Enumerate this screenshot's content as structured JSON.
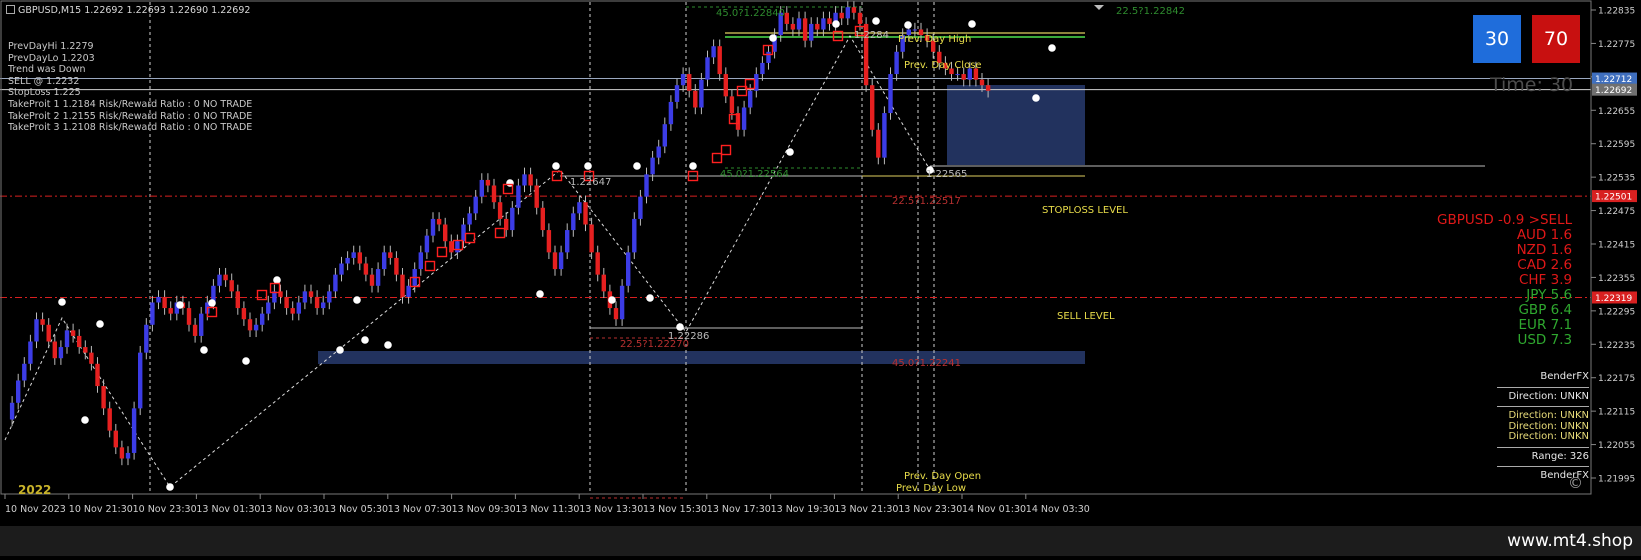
{
  "window": {
    "title": "GBPUSD,M15  1.22692 1.22693 1.22690 1.22692",
    "year_label": "2022"
  },
  "info_panel": [
    "PrevDayHi 1.2279",
    "PrevDayLo 1.2203",
    "Trend was Down",
    "SELL @ 1.2232",
    "StopLoss 1.225",
    "TakeProit 1 1.2184 Risk/Reward Ratio : 0 NO TRADE",
    "TakeProit 2 1.2155 Risk/Reward Ratio : 0 NO TRADE",
    "TakeProit 3 1.2108 Risk/Reward Ratio : 0 NO TRADE"
  ],
  "price_axis": {
    "ticks": [
      "1.22835",
      "1.22775",
      "1.22715",
      "1.22655",
      "1.22595",
      "1.22535",
      "1.22475",
      "1.22415",
      "1.22355",
      "1.22295",
      "1.22235",
      "1.22175",
      "1.22115",
      "1.22055",
      "1.21995"
    ],
    "tags": [
      {
        "label": "1.22712",
        "price": 1.22712,
        "bg": "#3f6fbf"
      },
      {
        "label": "1.22692",
        "price": 1.22692,
        "bg": "#707070"
      },
      {
        "label": "1.22501",
        "price": 1.22501,
        "bg": "#d82020"
      },
      {
        "label": "1.22319",
        "price": 1.22319,
        "bg": "#d82020"
      }
    ]
  },
  "time_axis": [
    "10 Nov 2023",
    "10 Nov 21:30",
    "10 Nov 23:30",
    "13 Nov 01:30",
    "13 Nov 03:30",
    "13 Nov 05:30",
    "13 Nov 07:30",
    "13 Nov 09:30",
    "13 Nov 11:30",
    "13 Nov 13:30",
    "13 Nov 15:30",
    "13 Nov 17:30",
    "13 Nov 19:30",
    "13 Nov 21:30",
    "13 Nov 23:30",
    "14 Nov 01:30",
    "14 Nov 03:30"
  ],
  "levels": {
    "stoploss_label": "STOPLOSS LEVEL",
    "sell_label": "SELL LEVEL",
    "prev_day_high": "Prev. Day High",
    "prev_day_close": "Prev. Day Close",
    "prev_day_open": "Prev. Day Open",
    "prev_day_low": "Prev. Day Low"
  },
  "annotations": {
    "fib_top_green": "45.0?1.22840",
    "fib_right_green": "22.5?1.22842",
    "fib_mid_green": "45.0?1.22564",
    "fib_red_1": "22.5?1.22517",
    "fib_red_2": "22.5?1.22270",
    "fib_red_3": "45.0?1.22241",
    "swing_1": "1.22647",
    "swing_2": "1.22286",
    "swing_3": "1.22565",
    "swing_4": "1.2284"
  },
  "signal_boxes": {
    "left_value": "30",
    "right_value": "70"
  },
  "timer": "Time: 30",
  "currency_strength": {
    "header": "GBPUSD -0.9  >SELL",
    "rows": [
      {
        "label": "AUD",
        "value": "1.6",
        "color": "#e01818"
      },
      {
        "label": "NZD",
        "value": "1.6",
        "color": "#e01818"
      },
      {
        "label": "CAD",
        "value": "2.6",
        "color": "#e01818"
      },
      {
        "label": "CHF",
        "value": "3.9",
        "color": "#e01818"
      },
      {
        "label": "JPY",
        "value": "5.6",
        "color": "#2fa82f"
      },
      {
        "label": "GBP",
        "value": "6.4",
        "color": "#2fa82f"
      },
      {
        "label": "EUR",
        "value": "7.1",
        "color": "#2fa82f"
      },
      {
        "label": "USD",
        "value": "7.3",
        "color": "#2fa82f"
      }
    ]
  },
  "bender_panel": {
    "title": "BenderFX",
    "direction_main": "Direction: UNKN",
    "directions": [
      "Direction: UNKN",
      "Direction: UNKN",
      "Direction: UNKN"
    ],
    "range": "Range: 326",
    "footer": "BenderFX"
  },
  "copyright_symbol": "©",
  "watermark": "www.mt4.shop",
  "colors": {
    "bull": "#3c3ce6",
    "bear": "#e62020",
    "stop_line": "#d82020",
    "fib_green": "#2e8b2e",
    "fib_red": "#b83030",
    "zone": "#22325e"
  }
}
